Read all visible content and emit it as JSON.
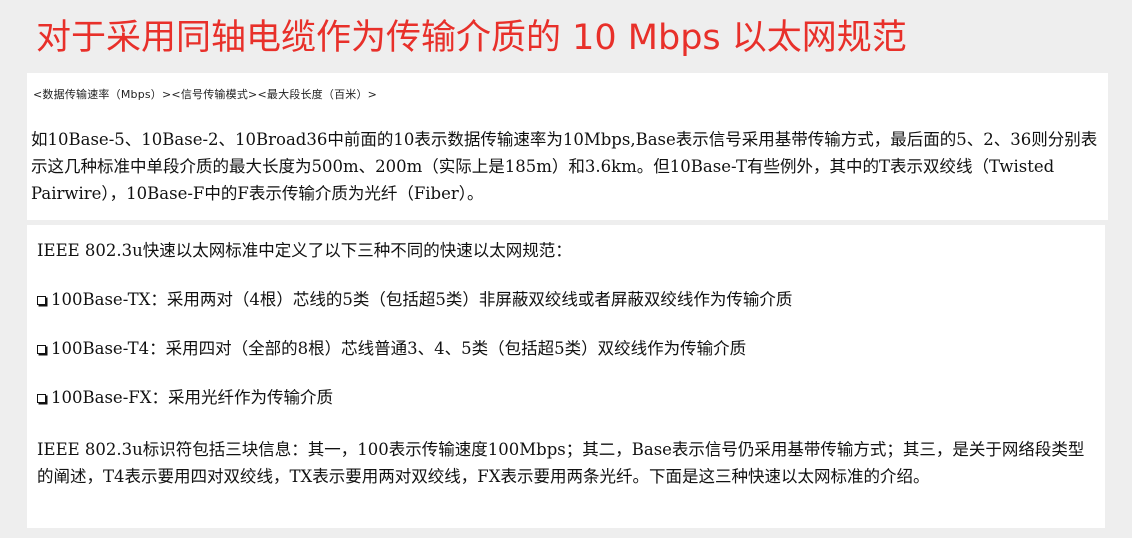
{
  "title": "对于采用同轴电缆作为传输介质的 10 Mbps 以太网规范",
  "top_panel": {
    "format_line": "<数据传输速率（Mbps）><信号传输模式><最大段长度（百米）>",
    "paragraph": "如10Base-5、10Base-2、10Broad36中前面的10表示数据传输速率为10Mbps,Base表示信号采用基带传输方式，最后面的5、2、36则分别表示这几种标准中单段介质的最大长度为500m、200m（实际上是185m）和3.6km。但10Base-T有些例外，其中的T表示双绞线（Twisted Pairwire），10Base-F中的F表示传输介质为光纤（Fiber）。"
  },
  "bottom_panel": {
    "heading": "IEEE 802.3u快速以太网标准中定义了以下三种不同的快速以太网规范：",
    "standards": [
      {
        "icon": "checkbox-icon",
        "text": "100Base-TX：采用两对（4根）芯线的5类（包括超5类）非屏蔽双绞线或者屏蔽双绞线作为传输介质"
      },
      {
        "icon": "checkbox-icon",
        "text": "100Base-T4：采用四对（全部的8根）芯线普通3、4、5类（包括超5类）双绞线作为传输介质"
      },
      {
        "icon": "checkbox-icon",
        "text": "100Base-FX：采用光纤作为传输介质"
      }
    ],
    "paragraph": "IEEE 802.3u标识符包括三块信息：其一，100表示传输速度100Mbps；其二，Base表示信号仍采用基带传输方式；其三，是关于网络段类型的阐述，T4表示要用四对双绞线，TX表示要用两对双绞线，FX表示要用两条光纤。下面是这三种快速以太网标准的介绍。"
  }
}
